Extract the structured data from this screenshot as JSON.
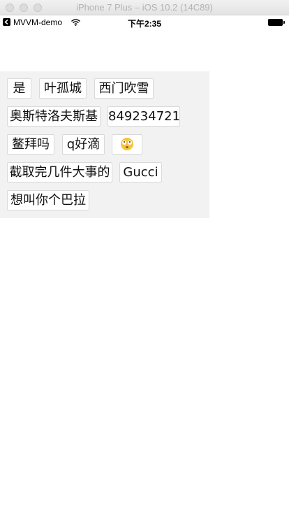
{
  "window": {
    "title": "iPhone 7 Plus – iOS 10.2 (14C89)"
  },
  "status_bar": {
    "back_icon": "back-arrow-icon",
    "carrier": "MVVM-demo",
    "wifi_icon": "wifi-icon",
    "time": "下午2:35",
    "battery_icon": "battery-icon"
  },
  "tags": [
    {
      "label": "是"
    },
    {
      "label": "叶孤城"
    },
    {
      "label": "西门吹雪"
    },
    {
      "label": "奥斯特洛夫斯基"
    },
    {
      "label": "849234721"
    },
    {
      "label": "鳌拜吗"
    },
    {
      "label": "q好滴"
    },
    {
      "label": "",
      "icon": "rolling-eyes-emoji"
    },
    {
      "label": "截取完几件大事的"
    },
    {
      "label": "Gucci"
    },
    {
      "label": "想叫你个巴拉"
    }
  ],
  "colors": {
    "panel_background": "#f2f2f2",
    "tag_background": "#ffffff",
    "tag_border": "#d9d9d9"
  }
}
